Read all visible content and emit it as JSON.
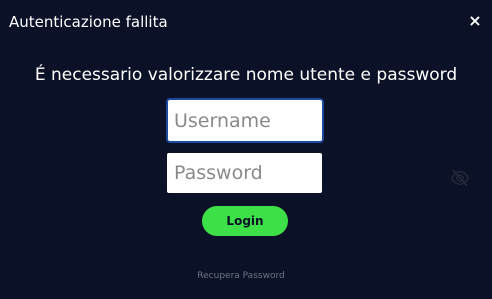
{
  "dialog": {
    "title": "Autenticazione fallita",
    "close_symbol": "×",
    "message": "É necessario valorizzare nome utente e password",
    "username": {
      "placeholder": "Username",
      "value": ""
    },
    "password": {
      "placeholder": "Password",
      "value": ""
    },
    "toggle_icon": "eye-slash-icon",
    "login_label": "Login",
    "recover_link": "Recupera Password"
  },
  "colors": {
    "background": "#0b1126",
    "accent_green": "#3ee047",
    "focus_border": "#1d4a9e",
    "muted_text": "#6d7486"
  }
}
